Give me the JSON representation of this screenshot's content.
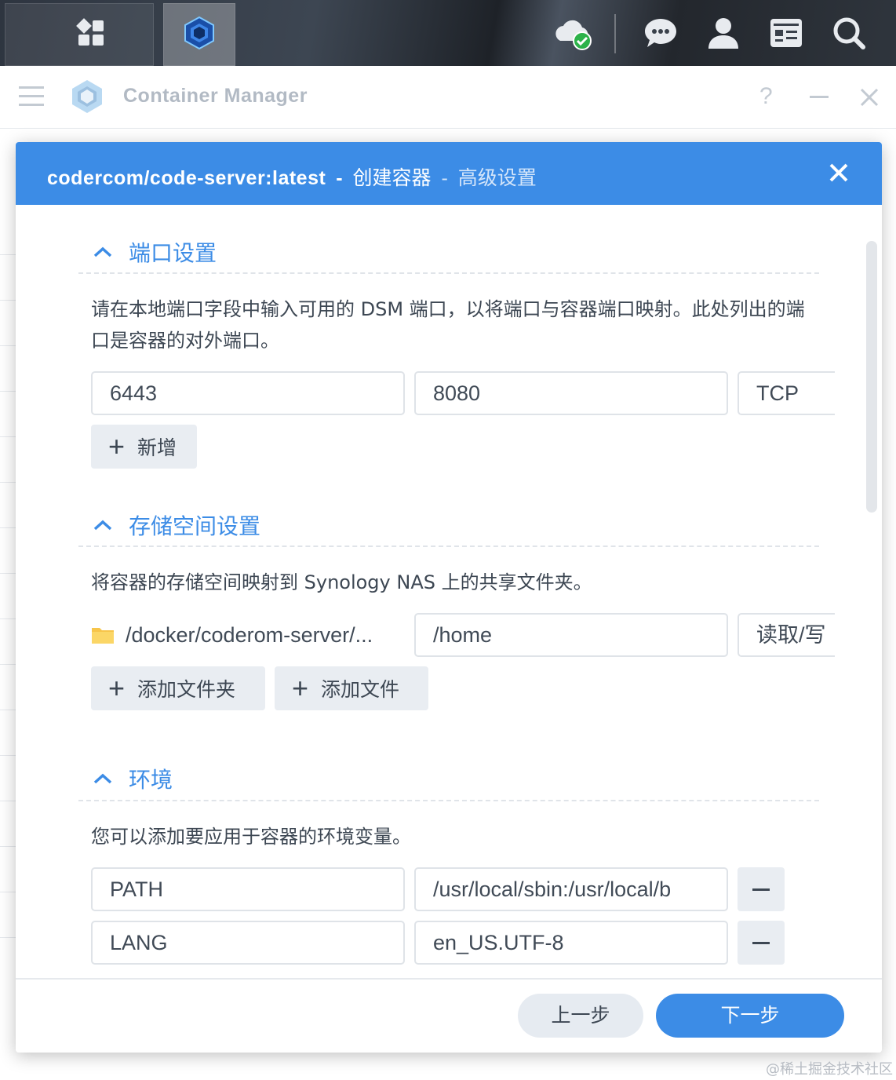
{
  "taskbar": {
    "icons": [
      "main-menu-icon",
      "container-manager-icon",
      "cloud-sync-icon",
      "chat-icon",
      "user-icon",
      "widgets-icon",
      "search-icon"
    ]
  },
  "app": {
    "title": "Container Manager",
    "help_label": "?"
  },
  "dialog": {
    "title_image": "codercom/code-server:latest",
    "title_sep": "-",
    "title_action": "创建容器",
    "title_sep2": "-",
    "title_step": "高级设置",
    "port_section": {
      "title": "端口设置",
      "description": "请在本地端口字段中输入可用的 DSM 端口，以将端口与容器端口映射。此处列出的端口是容器的对外端口。",
      "local_port": "6443",
      "container_port": "8080",
      "protocol": "TCP",
      "add_label": "新增"
    },
    "storage_section": {
      "title": "存储空间设置",
      "description": "将容器的存储空间映射到 Synology NAS 上的共享文件夹。",
      "folder_path": "/docker/coderom-server/...",
      "mount_path": "/home",
      "permission": "读取/写",
      "add_folder_label": "添加文件夹",
      "add_file_label": "添加文件"
    },
    "env_section": {
      "title": "环境",
      "description": "您可以添加要应用于容器的环境变量。",
      "rows": [
        {
          "key": "PATH",
          "value": "/usr/local/sbin:/usr/local/b"
        },
        {
          "key": "LANG",
          "value": "en_US.UTF-8"
        }
      ]
    },
    "footer": {
      "prev_label": "上一步",
      "next_label": "下一步"
    }
  },
  "watermark": "@稀土掘金技术社区",
  "colors": {
    "accent": "#3c8ce6",
    "header_bg": "#3c8ce6",
    "button_bg": "#e9edf2"
  }
}
